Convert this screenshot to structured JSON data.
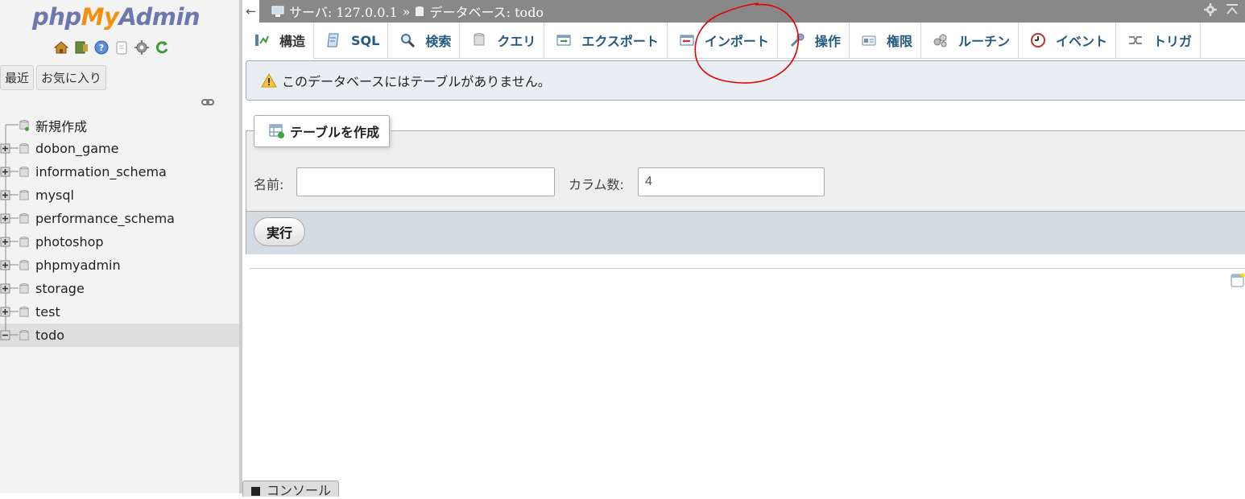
{
  "sidebar": {
    "logo": {
      "php": "php",
      "my": "My",
      "admin": "Admin"
    },
    "nav_icons": [
      "home-icon",
      "logout-icon",
      "help-icon",
      "docs-icon",
      "settings-icon",
      "reload-icon"
    ],
    "tabs": {
      "recent": "最近",
      "favorites": "お気に入り"
    },
    "tree": {
      "new_label": "新規作成",
      "databases": [
        "dobon_game",
        "information_schema",
        "mysql",
        "performance_schema",
        "photoshop",
        "phpmyadmin",
        "storage",
        "test",
        "todo"
      ],
      "active": "todo"
    }
  },
  "topbar": {
    "back": "←",
    "server": "サーバ: 127.0.0.1",
    "separator": "»",
    "database": "データベース: todo"
  },
  "tabs": [
    {
      "label": "構造",
      "icon": "structure-icon",
      "active": true
    },
    {
      "label": "SQL",
      "icon": "sql-icon"
    },
    {
      "label": "検索",
      "icon": "search-icon"
    },
    {
      "label": "クエリ",
      "icon": "query-icon"
    },
    {
      "label": "エクスポート",
      "icon": "export-icon"
    },
    {
      "label": "インポート",
      "icon": "import-icon"
    },
    {
      "label": "操作",
      "icon": "operations-icon"
    },
    {
      "label": "権限",
      "icon": "privileges-icon"
    },
    {
      "label": "ルーチン",
      "icon": "routines-icon"
    },
    {
      "label": "イベント",
      "icon": "events-icon"
    },
    {
      "label": "トリガ",
      "icon": "triggers-icon"
    }
  ],
  "notice": {
    "text": "このデータベースにはテーブルがありません。"
  },
  "create_table": {
    "legend": "テーブルを作成",
    "name_label": "名前:",
    "name_value": "",
    "columns_label": "カラム数:",
    "columns_value": "4",
    "submit": "実行"
  },
  "console": {
    "label": "コンソール"
  },
  "colors": {
    "link": "#235a81",
    "topbar": "#888888",
    "notice_bg": "#e8eef1",
    "annotation": "#e00000"
  }
}
